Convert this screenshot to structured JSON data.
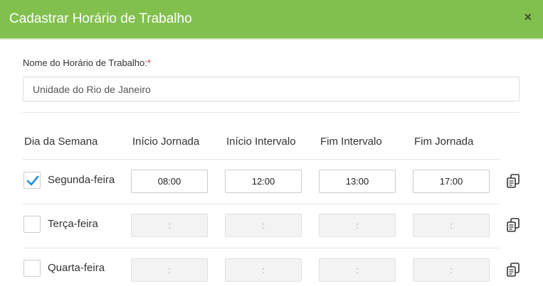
{
  "dialog": {
    "title": "Cadastrar Horário de Trabalho",
    "close_label": "×"
  },
  "form": {
    "name_label": "Nome do Horário de Trabalho:",
    "required_mark": "*",
    "name_value": "Unidade do Rio de Janeiro"
  },
  "table": {
    "headers": [
      "Dia da Semana",
      "Início Jornada",
      "Início Intervalo",
      "Fim Intervalo",
      "Fim Jornada"
    ],
    "rows": [
      {
        "day": "Segunda-feira",
        "checked": true,
        "times": [
          "08:00",
          "12:00",
          "13:00",
          "17:00"
        ]
      },
      {
        "day": "Terça-feira",
        "checked": false,
        "times": [
          ":",
          ":",
          ":",
          ":"
        ]
      },
      {
        "day": "Quarta-feira",
        "checked": false,
        "times": [
          ":",
          ":",
          ":",
          ":"
        ]
      }
    ]
  },
  "colors": {
    "header_bg": "#82c04e",
    "check_color": "#1e90d6"
  },
  "icons": {
    "close": "close-icon",
    "check": "check-icon",
    "copy": "copy-icon"
  }
}
